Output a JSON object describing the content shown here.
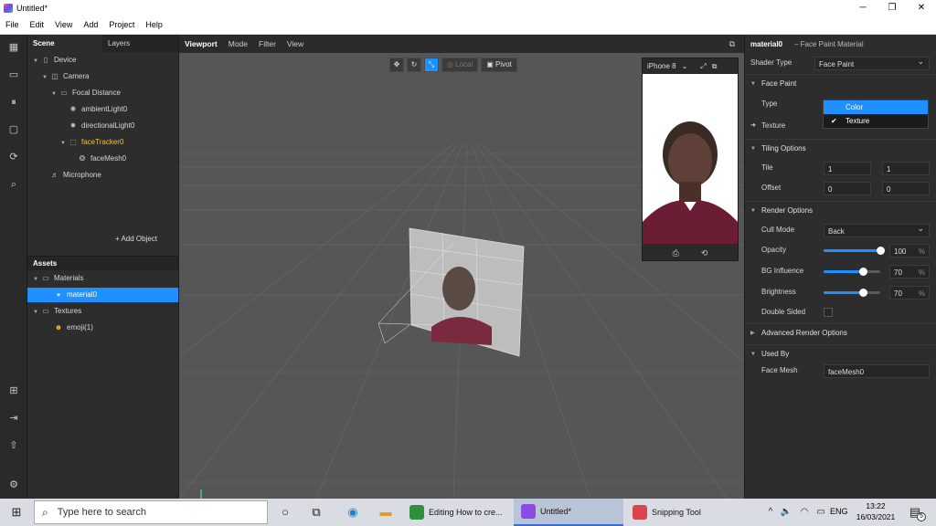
{
  "window": {
    "title": "Untitled*"
  },
  "menu": [
    "File",
    "Edit",
    "View",
    "Add",
    "Project",
    "Help"
  ],
  "scene_panel": {
    "tabs": [
      "Scene",
      "Layers"
    ],
    "tree": [
      {
        "label": "Device",
        "icon": "device-icon",
        "depth": 0,
        "arrow": "▼",
        "color": "#d6d6d6"
      },
      {
        "label": "Camera",
        "icon": "camera-icon",
        "depth": 1,
        "arrow": "▼",
        "color": "#d6d6d6"
      },
      {
        "label": "Focal Distance",
        "icon": "focal-distance-icon",
        "depth": 2,
        "arrow": "▼",
        "color": "#d6d6d6"
      },
      {
        "label": "ambientLight0",
        "icon": "ambient-light-icon",
        "depth": 3,
        "arrow": "",
        "color": "#d6d6d6"
      },
      {
        "label": "directionalLight0",
        "icon": "directional-light-icon",
        "depth": 3,
        "arrow": "",
        "color": "#d6d6d6"
      },
      {
        "label": "faceTracker0",
        "icon": "face-tracker-icon",
        "depth": 3,
        "arrow": "▼",
        "color": "#e8c14a"
      },
      {
        "label": "faceMesh0",
        "icon": "face-mesh-icon",
        "depth": 4,
        "arrow": "",
        "color": "#d6d6d6"
      },
      {
        "label": "Microphone",
        "icon": "microphone-icon",
        "depth": 1,
        "arrow": "",
        "color": "#d6d6d6"
      }
    ],
    "add_object": "Add Object"
  },
  "assets_panel": {
    "title": "Assets",
    "tree": [
      {
        "label": "Materials",
        "icon": "folder-icon",
        "depth": 0,
        "arrow": "▼",
        "selected": false
      },
      {
        "label": "material0",
        "icon": "material-sphere-icon",
        "depth": 1,
        "arrow": "",
        "selected": true
      },
      {
        "label": "Textures",
        "icon": "folder-icon",
        "depth": 0,
        "arrow": "▼",
        "selected": false
      },
      {
        "label": "emoji(1)",
        "icon": "emoji-icon",
        "depth": 1,
        "arrow": "",
        "selected": false
      }
    ]
  },
  "viewport": {
    "tabs": [
      "Viewport",
      "Mode",
      "Filter",
      "View"
    ],
    "tools": {
      "local": "Local",
      "pivot": "Pivot"
    },
    "device": "iPhone 8"
  },
  "inspector": {
    "object_name": "material0",
    "object_type": "– Face Paint Material",
    "shader_type_label": "Shader Type",
    "shader_type_value": "Face Paint",
    "face_paint": {
      "title": "Face Paint",
      "type_label": "Type",
      "texture_label": "Texture"
    },
    "type_popup": {
      "options": [
        "Color",
        "Texture"
      ],
      "highlighted": "Color",
      "checked": "Texture"
    },
    "tiling": {
      "title": "Tiling Options",
      "tile_label": "Tile",
      "tile_x": "1",
      "tile_y": "1",
      "offset_label": "Offset",
      "offset_x": "0",
      "offset_y": "0"
    },
    "render": {
      "title": "Render Options",
      "cull_label": "Cull Mode",
      "cull_value": "Back",
      "opacity_label": "Opacity",
      "opacity_value": "100",
      "opacity_level": 1.0,
      "bg_label": "BG Influence",
      "bg_value": "70",
      "bg_level": 0.7,
      "brightness_label": "Brightness",
      "brightness_value": "70",
      "brightness_level": 0.7,
      "unit": "%",
      "double_sided_label": "Double Sided"
    },
    "advanced": {
      "title": "Advanced Render Options"
    },
    "used_by": {
      "title": "Used By",
      "face_mesh_label": "Face Mesh",
      "face_mesh_value": "faceMesh0"
    }
  },
  "taskbar": {
    "search_placeholder": "Type here to search",
    "apps": [
      {
        "label": "Editing How to cre...",
        "color": "#2f8f3a",
        "active": false
      },
      {
        "label": "Untitled*",
        "color": "#8a4de0",
        "active": true
      },
      {
        "label": "Snipping Tool",
        "color": "#d8454a",
        "active": false
      }
    ],
    "lang": "ENG",
    "time": "13:22",
    "date": "16/03/2021",
    "notification_count": "5"
  }
}
